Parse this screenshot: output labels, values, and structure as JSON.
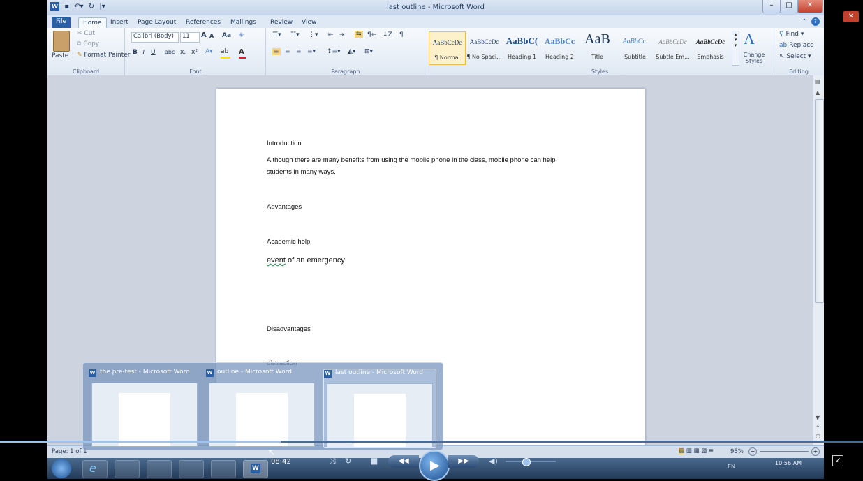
{
  "window": {
    "title": "last outline - Microsoft Word",
    "min_label": "–",
    "max_label": "□",
    "close_label": "✕"
  },
  "tabs": [
    "File",
    "Home",
    "Insert",
    "Page Layout",
    "References",
    "Mailings",
    "Review",
    "View"
  ],
  "clipboard": {
    "paste": "Paste",
    "cut": "Cut",
    "copy": "Copy",
    "format_painter": "Format Painter",
    "label": "Clipboard"
  },
  "font": {
    "name": "Calibri (Body)",
    "size": "11",
    "grow": "A",
    "shrink": "A",
    "change_case": "Aa",
    "bold": "B",
    "italic": "I",
    "underline": "U",
    "strike": "abc",
    "subscript": "x,",
    "superscript": "x²",
    "label": "Font"
  },
  "paragraph": {
    "label": "Paragraph"
  },
  "styles": {
    "label": "Styles",
    "items": [
      {
        "preview": "AaBbCcDc",
        "name": "¶ Normal"
      },
      {
        "preview": "AaBbCcDc",
        "name": "¶ No Spaci..."
      },
      {
        "preview": "AaBbC(",
        "name": "Heading 1"
      },
      {
        "preview": "AaBbCc",
        "name": "Heading 2"
      },
      {
        "preview": "AaB",
        "name": "Title"
      },
      {
        "preview": "AaBbCc.",
        "name": "Subtitle"
      },
      {
        "preview": "AaBbCcDc",
        "name": "Subtle Em..."
      },
      {
        "preview": "AaBbCcDc",
        "name": "Emphasis"
      }
    ],
    "change_styles": "Change Styles"
  },
  "editing": {
    "label": "Editing",
    "find": "Find",
    "replace": "Replace",
    "select": "Select"
  },
  "document": {
    "lines": [
      "Introduction",
      "Although  there are many benefits  from using the mobile  phone  in the class, mobile phone  can help",
      "students  in many ways.",
      "Advantages",
      "Academic help",
      "event",
      " of an emergency",
      "Disadvantages",
      "distraction"
    ]
  },
  "taskbar_popup": [
    {
      "title": "the pre-test - Microsoft Word"
    },
    {
      "title": "outline - Microsoft Word"
    },
    {
      "title": "last outline - Microsoft Word"
    }
  ],
  "status": {
    "page": "Page: 1 of 1",
    "zoom": "98%",
    "time": "10:56 AM",
    "lang": "EN"
  },
  "player": {
    "timestamp": "08:42",
    "progress": 0.325,
    "volume": 0.4
  }
}
